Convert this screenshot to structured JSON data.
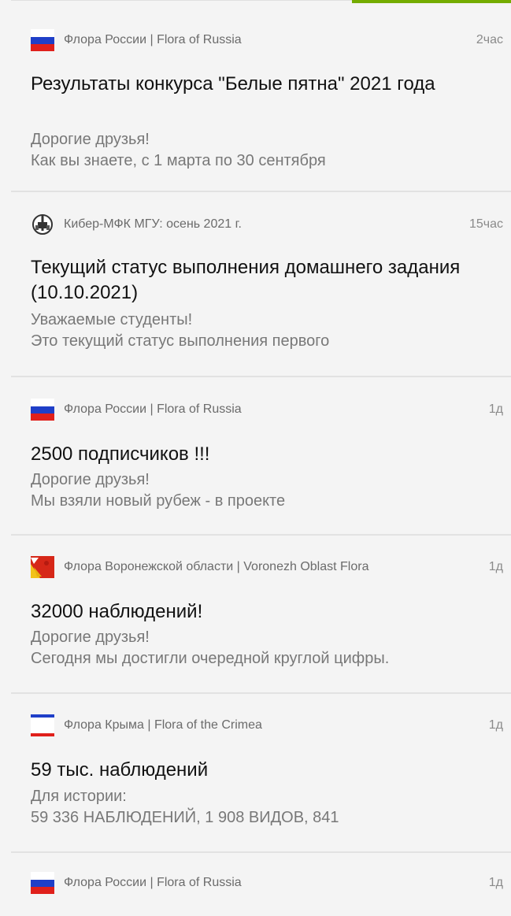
{
  "colors": {
    "accent": "#74ac00",
    "background": "#f4f4f4",
    "divider": "#e2e2e2",
    "title": "#111111",
    "preview": "#787878",
    "meta": "#6b6b6b"
  },
  "posts": [
    {
      "project": "Флора России | Flora of Russia",
      "project_icon": "russia-flag-icon",
      "time": "2час",
      "title": "Результаты конкурса \"Белые пятна\" 2021 года",
      "body_lines": [
        "Дорогие друзья!",
        "Как вы знаете, с 1 марта по 30 сентября"
      ]
    },
    {
      "project": "Кибер-МФК МГУ: осень 2021 г.",
      "project_icon": "msu-emblem-icon",
      "time": "15час",
      "title": "Текущий статус выполнения домашнего задания (10.10.2021)",
      "body_lines": [
        "Уважаемые студенты!",
        "Это текущий статус выполнения первого"
      ]
    },
    {
      "project": "Флора России | Flora of Russia",
      "project_icon": "russia-flag-icon",
      "time": "1д",
      "title": "2500 подписчиков !!!",
      "body_lines": [
        "Дорогие друзья!",
        "Мы взяли новый рубеж - в проекте"
      ]
    },
    {
      "project": "Флора Воронежской области | Voronezh Oblast Flora",
      "project_icon": "voronezh-emblem-icon",
      "time": "1д",
      "title": "32000 наблюдений!",
      "body_lines": [
        "Дорогие друзья!",
        "Сегодня мы достигли очередной круглой цифры."
      ]
    },
    {
      "project": "Флора Крыма | Flora of the Crimea",
      "project_icon": "crimea-flag-icon",
      "time": "1д",
      "title": "59 тыс. наблюдений",
      "body_lines": [
        "Для истории:",
        "59 336 НАБЛЮДЕНИЙ, 1 908 ВИДОВ, 841"
      ]
    },
    {
      "project": "Флора России | Flora of Russia",
      "project_icon": "russia-flag-icon",
      "time": "1д",
      "title": "",
      "body_lines": []
    }
  ]
}
